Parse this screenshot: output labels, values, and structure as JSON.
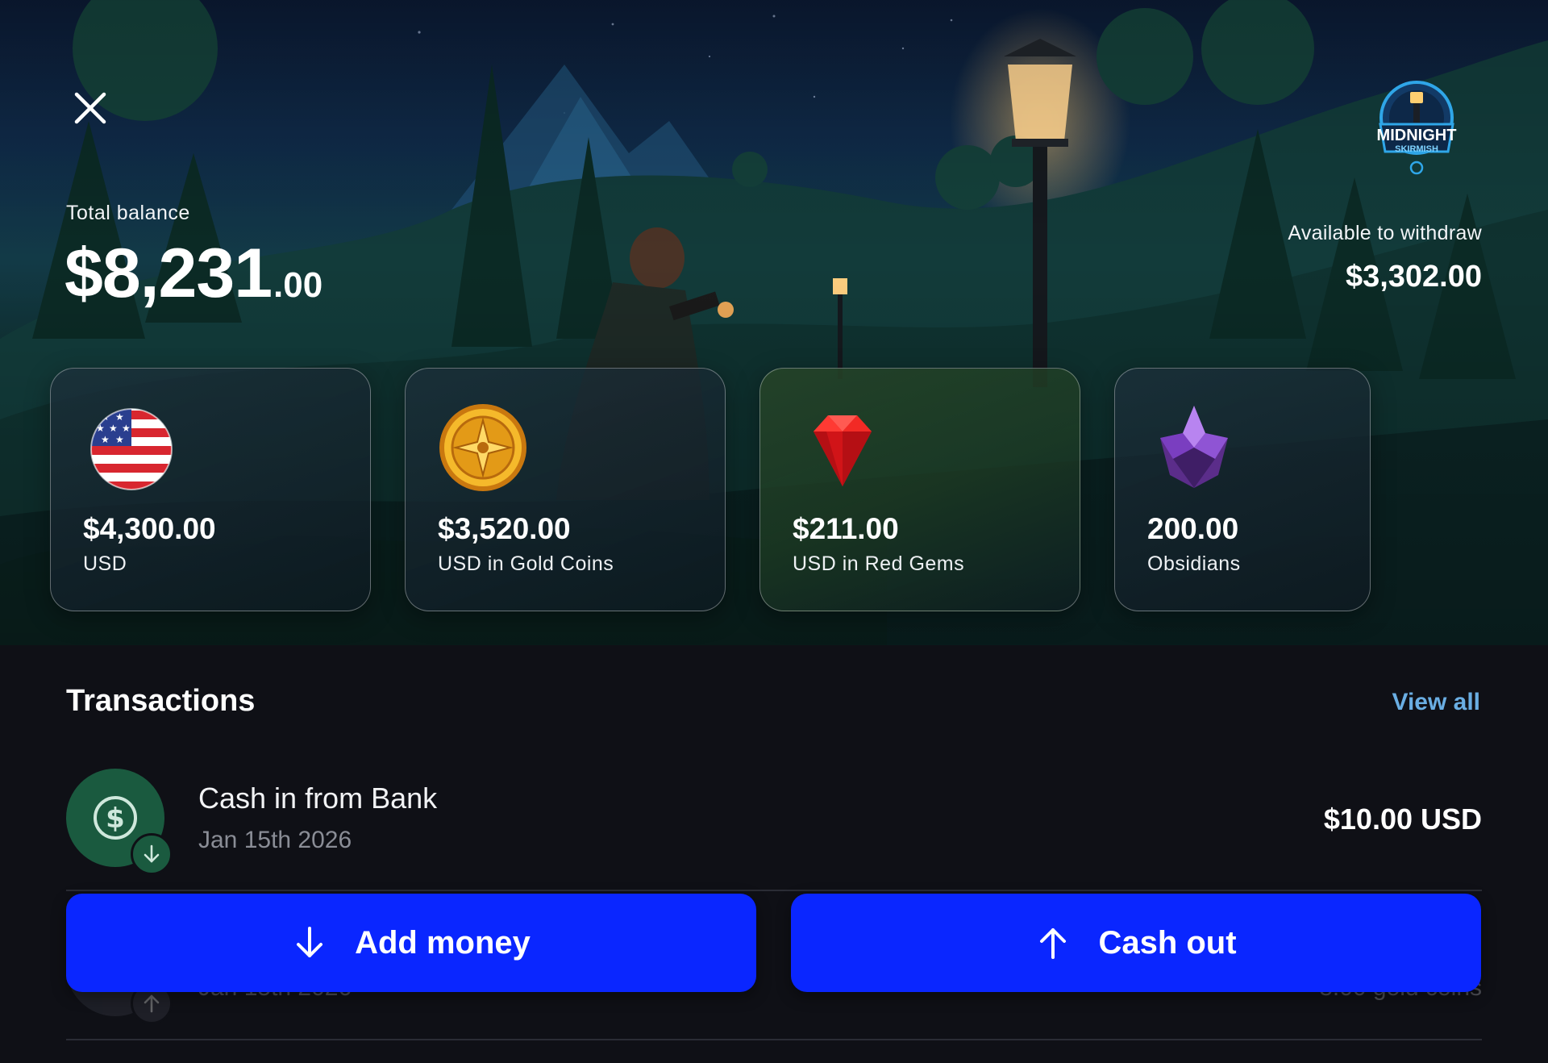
{
  "header": {
    "close_icon": "close-icon",
    "total_balance_label": "Total balance",
    "total_balance_dollars": "$8,231",
    "total_balance_cents": ".00",
    "available_label": "Available to withdraw",
    "available_value": "$3,302.00",
    "game_logo": {
      "line1": "MIDNIGHT",
      "line2": "SKIRMISH"
    }
  },
  "cards": [
    {
      "amount": "$4,300.00",
      "unit": "USD",
      "icon": "us-flag-icon"
    },
    {
      "amount": "$3,520.00",
      "unit": "USD in Gold Coins",
      "icon": "gold-coin-icon"
    },
    {
      "amount": "$211.00",
      "unit": "USD in Red Gems",
      "icon": "red-gem-icon"
    },
    {
      "amount": "200.00",
      "unit": "Obsidians",
      "icon": "obsidian-icon"
    }
  ],
  "transactions": {
    "title": "Transactions",
    "view_all": "View all",
    "items": [
      {
        "title": "Cash in from Bank",
        "date": "Jan 15th 2026",
        "amount": "$10.00 USD",
        "icon": "dollar-circle-icon",
        "badge": "arrow-down-icon"
      },
      {
        "title": "",
        "date": "Jan 15th 2026",
        "amount": "8.00 gold coins",
        "icon": "avatar",
        "badge": "arrow-up-icon"
      }
    ]
  },
  "actions": {
    "add_money": "Add money",
    "cash_out": "Cash out"
  },
  "colors": {
    "background": "#0f1016",
    "button": "#0a26ff",
    "link": "#6aaee3",
    "tx_icon_bg": "#1a5a3f"
  }
}
